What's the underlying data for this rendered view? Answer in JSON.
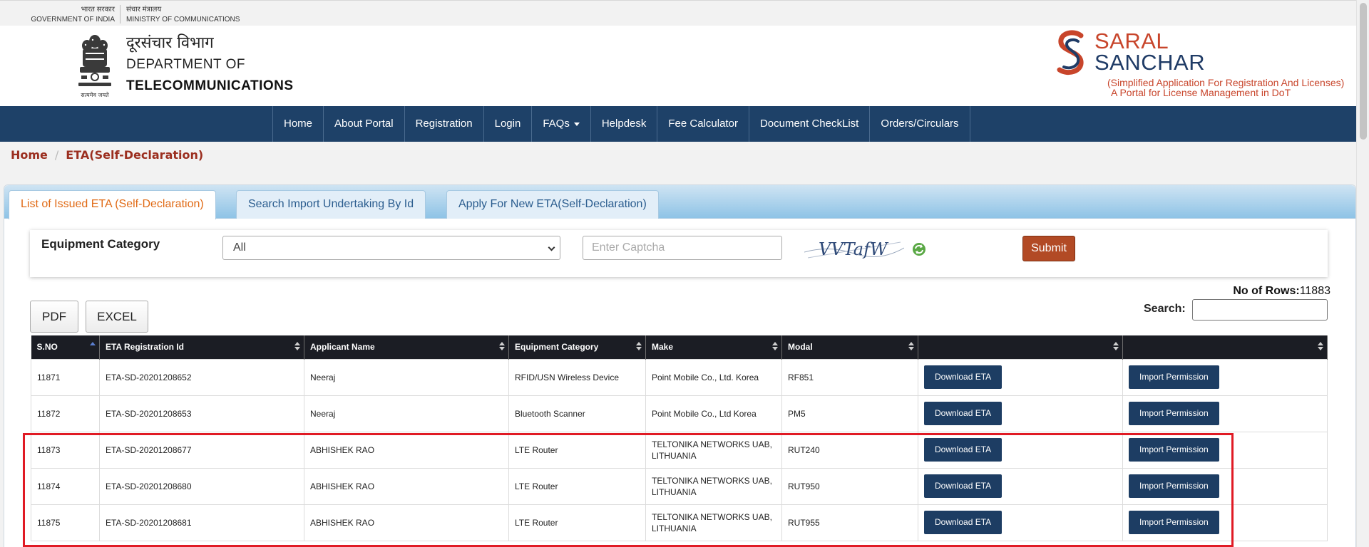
{
  "gov": {
    "left_hindi": "भारत सरकार",
    "left_en": "GOVERNMENT OF INDIA",
    "right_hindi": "संचार मंत्रालय",
    "right_en": "MINISTRY OF COMMUNICATIONS"
  },
  "header": {
    "emblem_caption": "सत्यमेव जयते",
    "dept_hindi": "दूरसंचार विभाग",
    "dept_line2": "DEPARTMENT OF",
    "dept_line3": "TELECOMMUNICATIONS",
    "logo_line1": "SARAL",
    "logo_line2": "SANCHAR",
    "logo_tag1": "(Simplified Application For Registration And Licenses)",
    "logo_tag2": "A Portal for License Management in DoT"
  },
  "nav": {
    "items": [
      {
        "label": "Home"
      },
      {
        "label": "About Portal"
      },
      {
        "label": "Registration"
      },
      {
        "label": "Login"
      },
      {
        "label": "FAQs"
      },
      {
        "label": "Helpdesk"
      },
      {
        "label": "Fee Calculator"
      },
      {
        "label": "Document CheckList"
      },
      {
        "label": "Orders/Circulars"
      }
    ]
  },
  "breadcrumb": {
    "home": "Home",
    "current": "ETA(Self-Declaration)"
  },
  "tabs": [
    {
      "label": "List of Issued ETA (Self-Declaration)",
      "active": true
    },
    {
      "label": "Search Import Undertaking By Id",
      "active": false
    },
    {
      "label": "Apply For New ETA(Self-Declaration)",
      "active": false
    }
  ],
  "filter": {
    "label": "Equipment Category",
    "selected": "All",
    "captcha_placeholder": "Enter Captcha",
    "captcha_text": "VVTafW",
    "submit_label": "Submit"
  },
  "table_controls": {
    "rows_label": "No of Rows:",
    "rows_value": "11883",
    "pdf_label": "PDF",
    "excel_label": "EXCEL",
    "search_label": "Search:"
  },
  "table": {
    "columns": [
      "S.NO",
      "ETA Registration Id",
      "Applicant Name",
      "Equipment Category",
      "Make",
      "Modal",
      "",
      ""
    ],
    "download_label": "Download ETA",
    "import_label": "Import Permission",
    "rows": [
      {
        "sno": "11871",
        "id": "ETA-SD-20201208652",
        "applicant": "Neeraj",
        "category": "RFID/USN Wireless Device",
        "make": "Point Mobile Co., Ltd. Korea",
        "modal": "RF851"
      },
      {
        "sno": "11872",
        "id": "ETA-SD-20201208653",
        "applicant": "Neeraj",
        "category": "Bluetooth Scanner",
        "make": "Point Mobile Co., Ltd Korea",
        "modal": "PM5"
      },
      {
        "sno": "11873",
        "id": "ETA-SD-20201208677",
        "applicant": "ABHISHEK RAO",
        "category": "LTE Router",
        "make": "TELTONIKA NETWORKS UAB, LITHUANIA",
        "modal": "RUT240"
      },
      {
        "sno": "11874",
        "id": "ETA-SD-20201208680",
        "applicant": "ABHISHEK RAO",
        "category": "LTE Router",
        "make": "TELTONIKA NETWORKS UAB, LITHUANIA",
        "modal": "RUT950"
      },
      {
        "sno": "11875",
        "id": "ETA-SD-20201208681",
        "applicant": "ABHISHEK RAO",
        "category": "LTE Router",
        "make": "TELTONIKA NETWORKS UAB, LITHUANIA",
        "modal": "RUT955"
      }
    ]
  },
  "colors": {
    "nav_bg": "#1e4168",
    "brand_red": "#c8452b",
    "brand_blue": "#1f3b66",
    "table_head": "#1b1d24",
    "button_blue": "#1d3d63",
    "submit": "#b24a25",
    "highlight": "#e01a24"
  }
}
